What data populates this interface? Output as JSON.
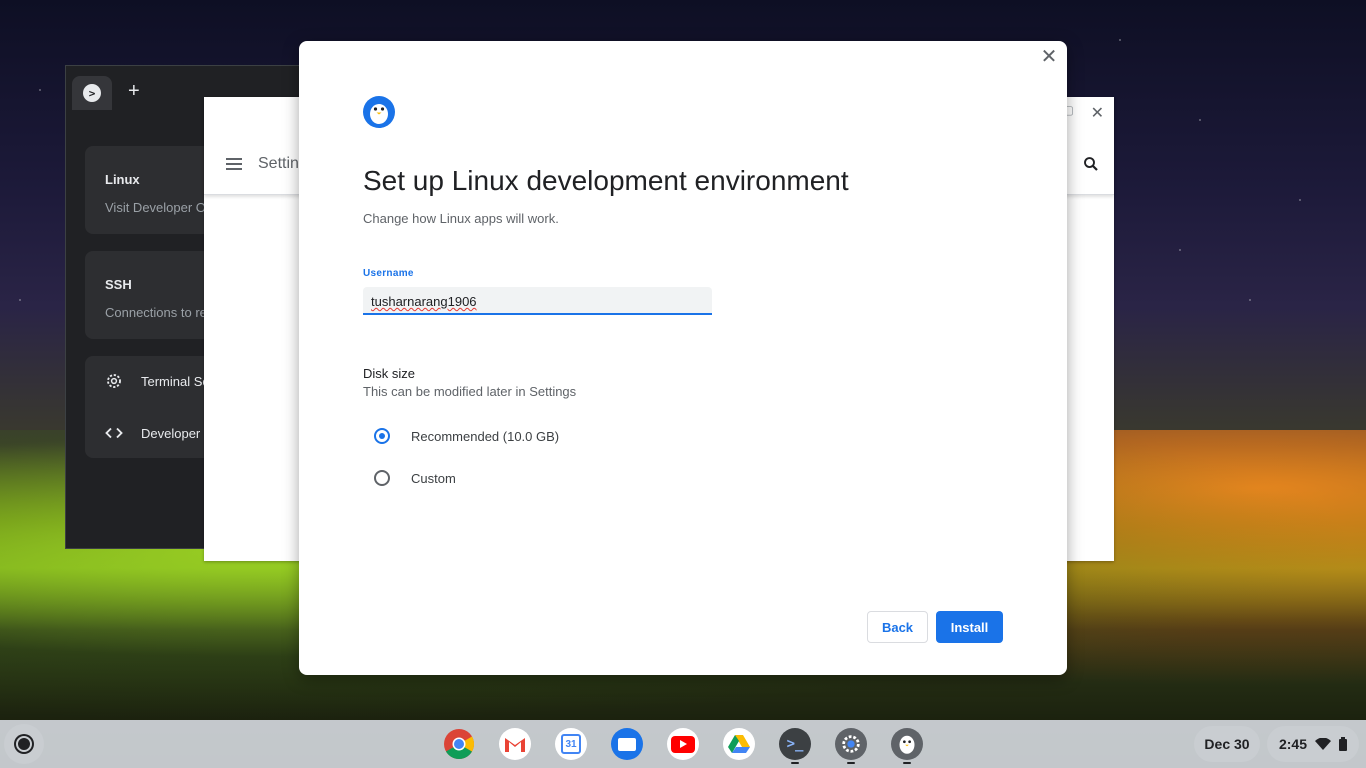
{
  "terminal_window": {
    "cards": {
      "linux": {
        "title": "Linux",
        "subtitle": "Visit Developer Options"
      },
      "ssh": {
        "title": "SSH",
        "subtitle": "Connections to remote machines"
      },
      "terminal_settings": "Terminal Settings",
      "developer_settings": "Developer Settings"
    }
  },
  "settings_window": {
    "title": "Settings"
  },
  "dialog": {
    "title": "Set up Linux development environment",
    "subtitle": "Change how Linux apps will work.",
    "username_label": "Username",
    "username_value": "tusharnarang1906",
    "disk_size_title": "Disk size",
    "disk_size_subtitle": "This can be modified later in Settings",
    "options": [
      {
        "label": "Recommended (10.0 GB)",
        "selected": true
      },
      {
        "label": "Custom",
        "selected": false
      }
    ],
    "back_label": "Back",
    "install_label": "Install",
    "close_glyph": "✕"
  },
  "shelf": {
    "apps": [
      "chrome-icon",
      "gmail-icon",
      "calendar-icon",
      "files-icon",
      "youtube-icon",
      "drive-icon",
      "terminal-icon",
      "settings-icon",
      "linux-penguin-icon"
    ],
    "calendar_day": "31",
    "date": "Dec 30",
    "time": "2:45"
  },
  "colors": {
    "accent": "#1a73e8",
    "dialog_bg": "#ffffff",
    "terminal_bg": "#202124"
  }
}
